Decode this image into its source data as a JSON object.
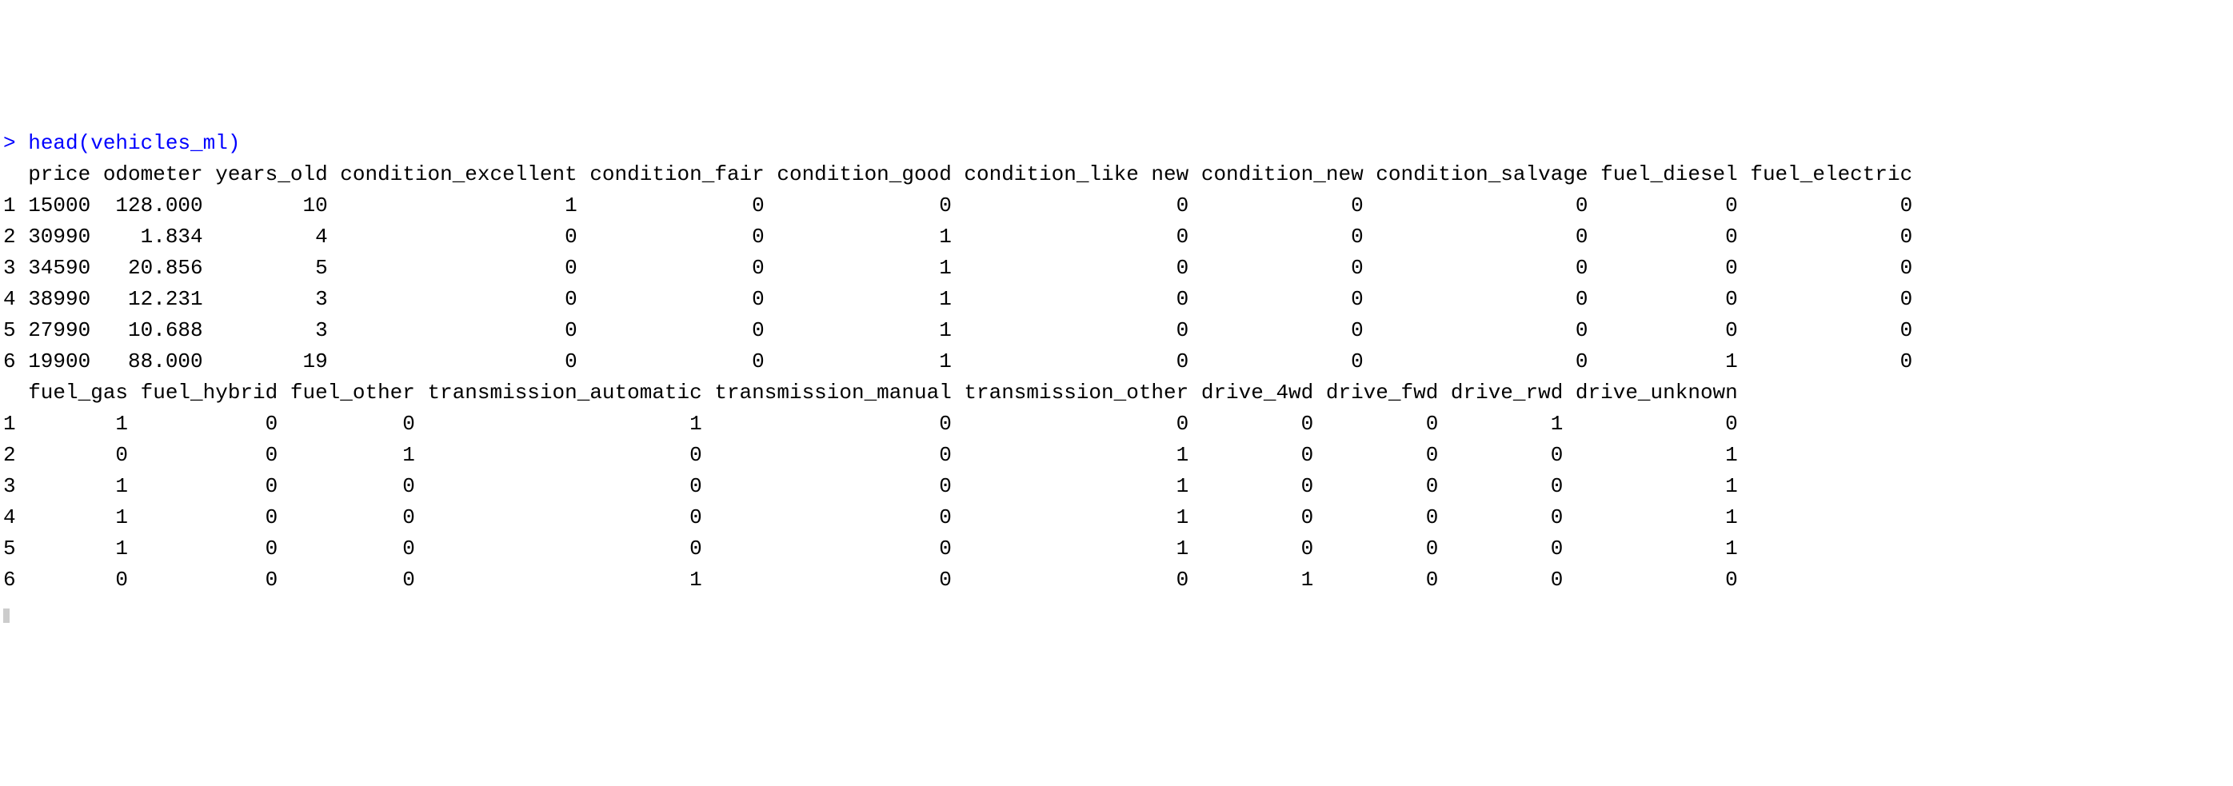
{
  "prompt_char": "> ",
  "command": "head(vehicles_ml)",
  "block1": {
    "header": "  price odometer years_old condition_excellent condition_fair condition_good condition_like new condition_new condition_salvage fuel_diesel fuel_electric",
    "rows": [
      "1 15000  128.000        10                   1              0              0                  0             0                 0           0             0",
      "2 30990    1.834         4                   0              0              1                  0             0                 0           0             0",
      "3 34590   20.856         5                   0              0              1                  0             0                 0           0             0",
      "4 38990   12.231         3                   0              0              1                  0             0                 0           0             0",
      "5 27990   10.688         3                   0              0              1                  0             0                 0           0             0",
      "6 19900   88.000        19                   0              0              1                  0             0                 0           1             0"
    ]
  },
  "block2": {
    "header": "  fuel_gas fuel_hybrid fuel_other transmission_automatic transmission_manual transmission_other drive_4wd drive_fwd drive_rwd drive_unknown",
    "rows": [
      "1        1           0          0                      1                   0                  0         0         0         1             0",
      "2        0           0          1                      0                   0                  1         0         0         0             1",
      "3        1           0          0                      0                   0                  1         0         0         0             1",
      "4        1           0          0                      0                   0                  1         0         0         0             1",
      "5        1           0          0                      0                   0                  1         0         0         0             1",
      "6        0           0          0                      1                   0                  0         1         0         0             0"
    ]
  }
}
